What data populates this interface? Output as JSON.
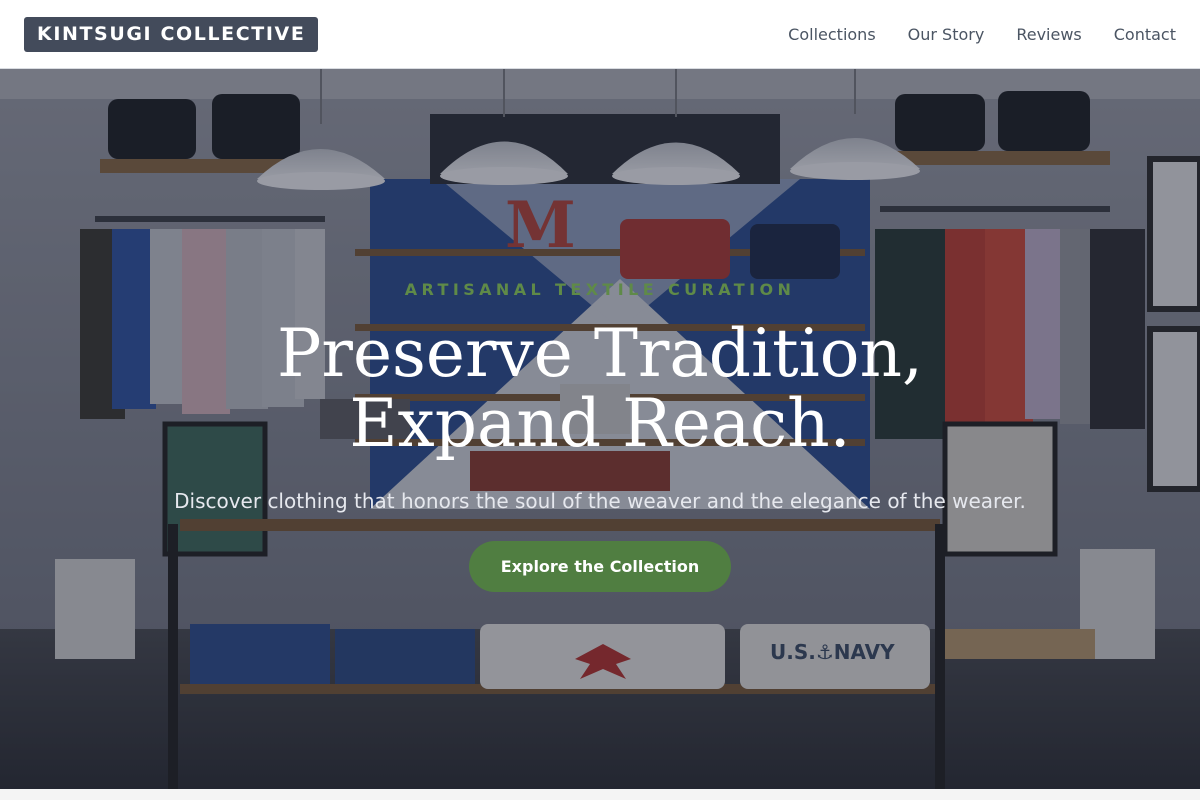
{
  "brand": {
    "name": "KINTSUGI COLLECTIVE"
  },
  "nav": {
    "items": [
      {
        "label": "Collections"
      },
      {
        "label": "Our Story"
      },
      {
        "label": "Reviews"
      },
      {
        "label": "Contact"
      }
    ]
  },
  "hero": {
    "eyebrow": "ARTISANAL TEXTILE CURATION",
    "headline": "Preserve Tradition, Expand Reach.",
    "subtitle": "Discover clothing that honors the soul of the weaver and the elegance of the wearer.",
    "cta_label": "Explore the Collection",
    "background_image": "clothing-boutique-interior-photo",
    "scene_text": {
      "sign_letter": "M",
      "navy_shirt": "U.S.⚓NAVY"
    }
  },
  "colors": {
    "brand_bg": "#434b5b",
    "accent_green": "#507e41",
    "eyebrow_green": "#5f8a48",
    "nav_text": "#4b5563"
  }
}
